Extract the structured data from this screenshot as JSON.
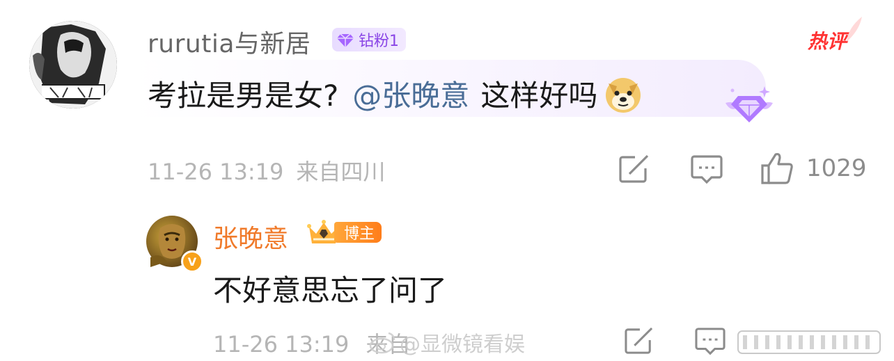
{
  "top_comment": {
    "username": "rurutia与新居",
    "fan_badge": "钻粉1",
    "hot_label": "热评",
    "text_before": "考拉是男是女?",
    "mention": "@张晚意",
    "text_after": "这样好吗",
    "emoji": "doge-emoji",
    "time": "11-26 13:19",
    "location": "来自四川",
    "like_count": "1029"
  },
  "reply": {
    "username": "张晚意",
    "badge": "博主",
    "verify": "V",
    "text": "不好意思忘了问了",
    "time": "11-26 13:19",
    "location_partial": "来自"
  },
  "watermark": {
    "text": "@显微镜看娱"
  },
  "colors": {
    "username": "#666666",
    "mention": "#4a6d97",
    "hot": "#ff3333",
    "fan_badge": "#8a46e6",
    "reply_name": "#f07a2a",
    "meta": "#b5b5b5"
  }
}
